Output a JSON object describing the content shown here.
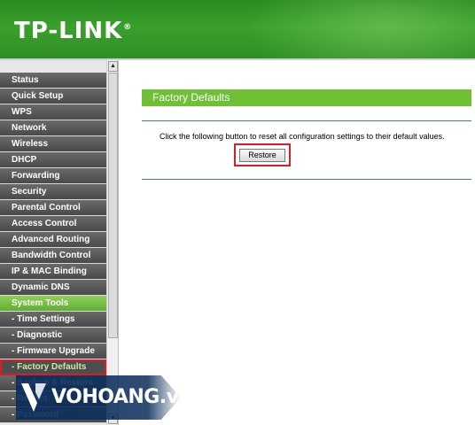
{
  "header": {
    "brand": "TP-LINK",
    "brand_reg": "®"
  },
  "sidebar": {
    "items": [
      {
        "label": "Status",
        "state": "normal"
      },
      {
        "label": "Quick Setup",
        "state": "normal"
      },
      {
        "label": "WPS",
        "state": "normal"
      },
      {
        "label": "Network",
        "state": "normal"
      },
      {
        "label": "Wireless",
        "state": "normal"
      },
      {
        "label": "DHCP",
        "state": "normal"
      },
      {
        "label": "Forwarding",
        "state": "normal"
      },
      {
        "label": "Security",
        "state": "normal"
      },
      {
        "label": "Parental Control",
        "state": "normal"
      },
      {
        "label": "Access Control",
        "state": "normal"
      },
      {
        "label": "Advanced Routing",
        "state": "normal"
      },
      {
        "label": "Bandwidth Control",
        "state": "normal"
      },
      {
        "label": "IP & MAC Binding",
        "state": "normal"
      },
      {
        "label": "Dynamic DNS",
        "state": "normal"
      },
      {
        "label": "System Tools",
        "state": "active"
      },
      {
        "label": "- Time Settings",
        "state": "sub"
      },
      {
        "label": "- Diagnostic",
        "state": "sub"
      },
      {
        "label": "- Firmware Upgrade",
        "state": "sub"
      },
      {
        "label": "- Factory Defaults",
        "state": "sub-selected"
      },
      {
        "label": "- Backup & Restore",
        "state": "sub"
      },
      {
        "label": "- Reboot",
        "state": "sub"
      },
      {
        "label": "- Password",
        "state": "sub"
      }
    ]
  },
  "main": {
    "title": "Factory Defaults",
    "description": "Click the following button to reset all configuration settings to their default values.",
    "restore_label": "Restore"
  },
  "watermark": {
    "text": "VOHOANG.vn"
  },
  "colors": {
    "header_green": "#3aa02c",
    "title_bar_green": "#6fc037",
    "menu_dark": "#4a4a4a",
    "highlight_red": "#d2202a"
  }
}
